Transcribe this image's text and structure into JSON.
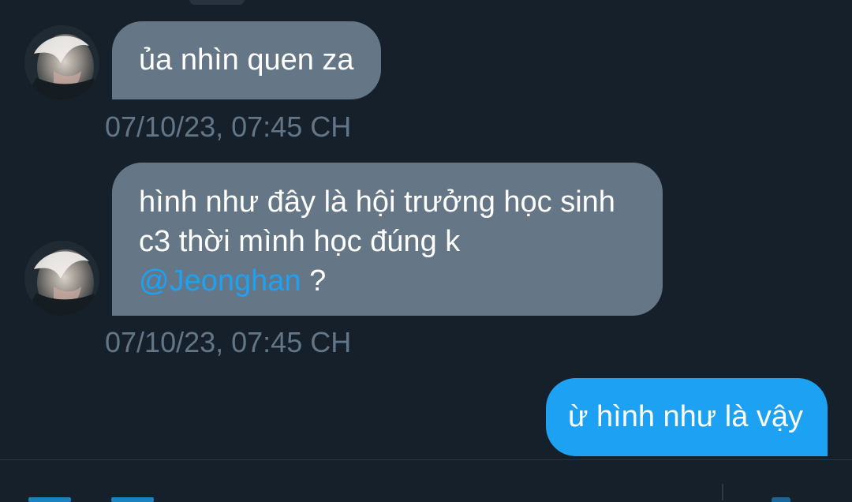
{
  "messages": [
    {
      "sender": "incoming",
      "lines": [
        "ủa nhìn quen za"
      ],
      "timestamp": "07/10/23, 07:45 CH"
    },
    {
      "sender": "incoming",
      "lines": [
        "hình như đây là hội trưởng học sinh",
        "c3 thời mình học đúng k"
      ],
      "mention": "@Jeonghan",
      "mention_suffix": " ?",
      "timestamp": "07/10/23, 07:45 CH"
    },
    {
      "sender": "outgoing",
      "lines": [
        "ừ hình như là vậy"
      ]
    }
  ],
  "colors": {
    "background": "#15202b",
    "incoming_bubble": "#657786",
    "outgoing_bubble": "#1da1f2",
    "mention": "#1da1f2",
    "timestamp": "#637687"
  },
  "icons": {
    "avatar": "avatar",
    "media": "media-icon",
    "gif": "gif-icon",
    "send": "send-icon"
  }
}
